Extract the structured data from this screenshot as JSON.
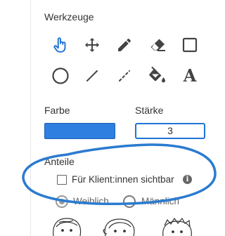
{
  "tools": {
    "heading": "Werkzeuge",
    "items": [
      {
        "id": "hand",
        "icon": "pointer-hand-icon",
        "active": true
      },
      {
        "id": "move",
        "icon": "move-arrows-icon"
      },
      {
        "id": "pencil",
        "icon": "pencil-icon"
      },
      {
        "id": "eraser",
        "icon": "eraser-icon"
      },
      {
        "id": "rectangle",
        "icon": "rectangle-icon"
      },
      {
        "id": "circle",
        "icon": "circle-icon"
      },
      {
        "id": "line",
        "icon": "line-icon"
      },
      {
        "id": "dashed-line",
        "icon": "dashed-line-icon"
      },
      {
        "id": "fill",
        "icon": "paint-bucket-icon"
      },
      {
        "id": "text",
        "icon": "text-icon",
        "glyph": "A"
      }
    ]
  },
  "color": {
    "label": "Farbe",
    "value": "#2f7fe0"
  },
  "stroke": {
    "label": "Stärke",
    "value": "3"
  },
  "shares": {
    "heading": "Anteile",
    "visible_checkbox_label": "Für Klient:innen sichtbar",
    "info_glyph": "i",
    "radio_options": [
      "Weiblich",
      "Männlich"
    ],
    "selected": "Weiblich"
  },
  "colors": {
    "accent": "#1f74d6",
    "highlight": "#2b7bd0"
  }
}
